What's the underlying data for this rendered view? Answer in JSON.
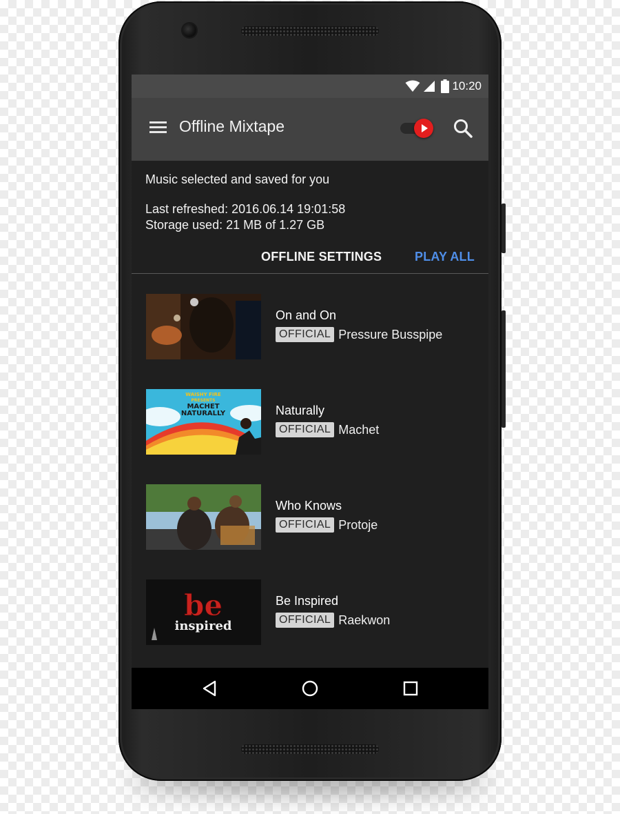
{
  "status_bar": {
    "time": "10:20",
    "icons": [
      "wifi-icon",
      "cell-signal-icon",
      "battery-icon"
    ]
  },
  "toolbar": {
    "title": "Offline Mixtape",
    "menu_icon": "menu-icon",
    "toggle_icon": "youtube-toggle-icon",
    "search_icon": "search-icon"
  },
  "info": {
    "description": "Music selected and saved for you",
    "last_refreshed": "Last refreshed: 2016.06.14 19:01:58",
    "storage_used": "Storage used: 21 MB of 1.27 GB"
  },
  "actions": {
    "offline_settings": "OFFLINE SETTINGS",
    "play_all": "PLAY ALL"
  },
  "colors": {
    "accent": "#4f8ee8",
    "toggle": "#e31e1e",
    "toolbar": "#424242",
    "background": "#1f1f1f"
  },
  "tracks": [
    {
      "title": "On and On",
      "badge": "OFFICIAL",
      "artist": "Pressure Busspipe"
    },
    {
      "title": "Naturally",
      "badge": "OFFICIAL",
      "artist": "Machet"
    },
    {
      "title": "Who Knows",
      "badge": "OFFICIAL",
      "artist": "Protoje"
    },
    {
      "title": "Be Inspired",
      "badge": "OFFICIAL",
      "artist": "Raekwon"
    }
  ],
  "thumbnails": {
    "naturally": {
      "line1": "WAISHY FIRE",
      "line2": "PRESENTS",
      "line3": "MACHET",
      "line4": "NATURALLY"
    },
    "be_inspired": {
      "line1": "be",
      "line2": "inspired"
    }
  },
  "navbar": {
    "icons": [
      "back-icon",
      "home-icon",
      "recents-icon"
    ]
  }
}
